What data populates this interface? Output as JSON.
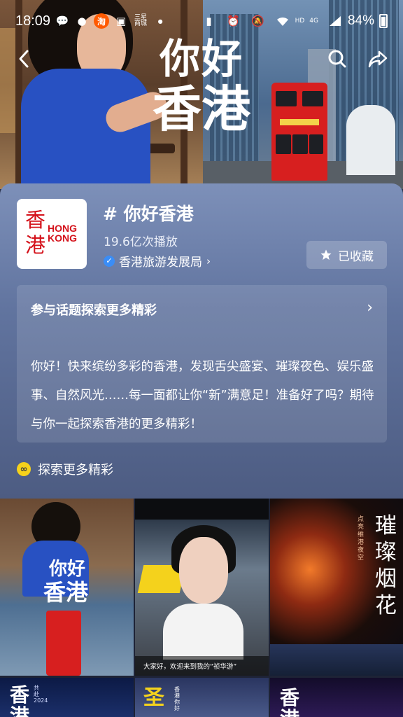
{
  "status_bar": {
    "time": "18:09",
    "carrier_small": "三星\n商城",
    "hd_label": "HD",
    "net_label": "4G",
    "battery_percent": "84%"
  },
  "hero": {
    "line1": "你好",
    "line2": "香港"
  },
  "topic": {
    "logo_chinese": "香港",
    "logo_line1": "HONG",
    "logo_line2": "KONG",
    "title": "# 你好香港",
    "plays": "19.6亿次播放",
    "publisher": "香港旅游发展局",
    "favorite_label": "已收藏"
  },
  "description": {
    "header": "参与话题探索更多精彩",
    "text": "你好！快来缤纷多彩的香港，发现舌尖盛宴、璀璨夜色、娱乐盛事、自然风光……每一面都让你“新”满意足！准备好了吗？期待与你一起探索香港的更多精彩！"
  },
  "explore": {
    "label": "探索更多精彩"
  },
  "videos": [
    {
      "title_line1": "你好",
      "title_line2": "香港"
    },
    {
      "subtitle": "大家好，欢迎来到我的“祯华游”"
    },
    {
      "vertical_title": "璀璨烟花",
      "small_vertical": "点亮维港夜空"
    },
    {
      "partial_title": "香港",
      "partial_small": "共赴2024"
    },
    {
      "partial_title": "圣",
      "partial_small": "香港 你好"
    },
    {
      "partial_title": "香港"
    }
  ],
  "colors": {
    "panel_top": "#7d90b9",
    "panel_bottom": "#4d5c82",
    "brand_red": "#d4121b",
    "verified_blue": "#3a8df6",
    "explore_yellow": "#f6d21b"
  }
}
